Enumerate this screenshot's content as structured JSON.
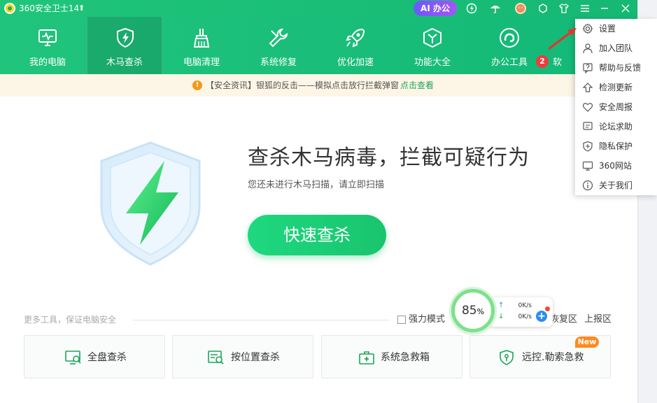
{
  "titlebar": {
    "title": "360安全卫士14",
    "update_arrow": "⬆",
    "ai_label": "AI 办公",
    "icons": [
      "speed-icon",
      "umbrella-icon",
      "avatar-icon",
      "skin-icon",
      "shirt-icon",
      "menu-icon",
      "minimize-icon",
      "close-icon"
    ]
  },
  "nav": {
    "items": [
      {
        "label": "我的电脑",
        "icon": "monitor-icon"
      },
      {
        "label": "木马查杀",
        "icon": "shield-bolt-icon"
      },
      {
        "label": "电脑清理",
        "icon": "broom-icon"
      },
      {
        "label": "系统修复",
        "icon": "wrench-icon"
      },
      {
        "label": "优化加速",
        "icon": "rocket-icon"
      },
      {
        "label": "功能大全",
        "icon": "cube-icon"
      },
      {
        "label": "办公工具",
        "icon": "office-icon"
      }
    ],
    "partial_label": "软",
    "annotation_badge": "2",
    "active_index": 1
  },
  "notice": {
    "icon": "!",
    "text": "【安全资讯】银狐的反击——模拟点击放行拦截弹窗",
    "link": "点击查看"
  },
  "hero": {
    "title": "查杀木马病毒，拦截可疑行为",
    "subtitle": "您还未进行木马扫描，请立即扫描",
    "scan_button": "快速查杀"
  },
  "tools": {
    "heading": "更多工具，保证电脑安全",
    "power_mode_label": "强力模式",
    "restore_link": "恢复区",
    "report_link": "上报区",
    "cards": [
      {
        "label": "全盘查杀",
        "icon": "full-scan-icon"
      },
      {
        "label": "按位置查杀",
        "icon": "location-scan-icon"
      },
      {
        "label": "系统急救箱",
        "icon": "first-aid-icon"
      },
      {
        "label": "远控.勒索急救",
        "icon": "ransom-shield-icon"
      }
    ],
    "new_badge": "New"
  },
  "widget": {
    "percent": "85",
    "percent_unit": "%",
    "upload_arrow": "↑",
    "download_arrow": "↓",
    "upload_speed": "0K/s",
    "download_speed": "0K/s",
    "plus": "+"
  },
  "menu": {
    "items": [
      {
        "label": "设置",
        "icon": "gear-icon"
      },
      {
        "label": "加入团队",
        "icon": "team-icon"
      },
      {
        "label": "帮助与反馈",
        "icon": "help-icon"
      },
      {
        "label": "检测更新",
        "icon": "update-icon"
      },
      {
        "label": "安全周报",
        "icon": "heart-icon"
      },
      {
        "label": "论坛求助",
        "icon": "forum-icon"
      },
      {
        "label": "隐私保护",
        "icon": "privacy-shield-icon"
      },
      {
        "label": "360网站",
        "icon": "website-icon"
      },
      {
        "label": "关于我们",
        "icon": "info-icon"
      }
    ]
  },
  "colors": {
    "brand_green": "#1fc57a",
    "accent_green": "#1aa65a",
    "annotation_red": "#f03c3c",
    "ai_purple": "#7b5af8"
  }
}
